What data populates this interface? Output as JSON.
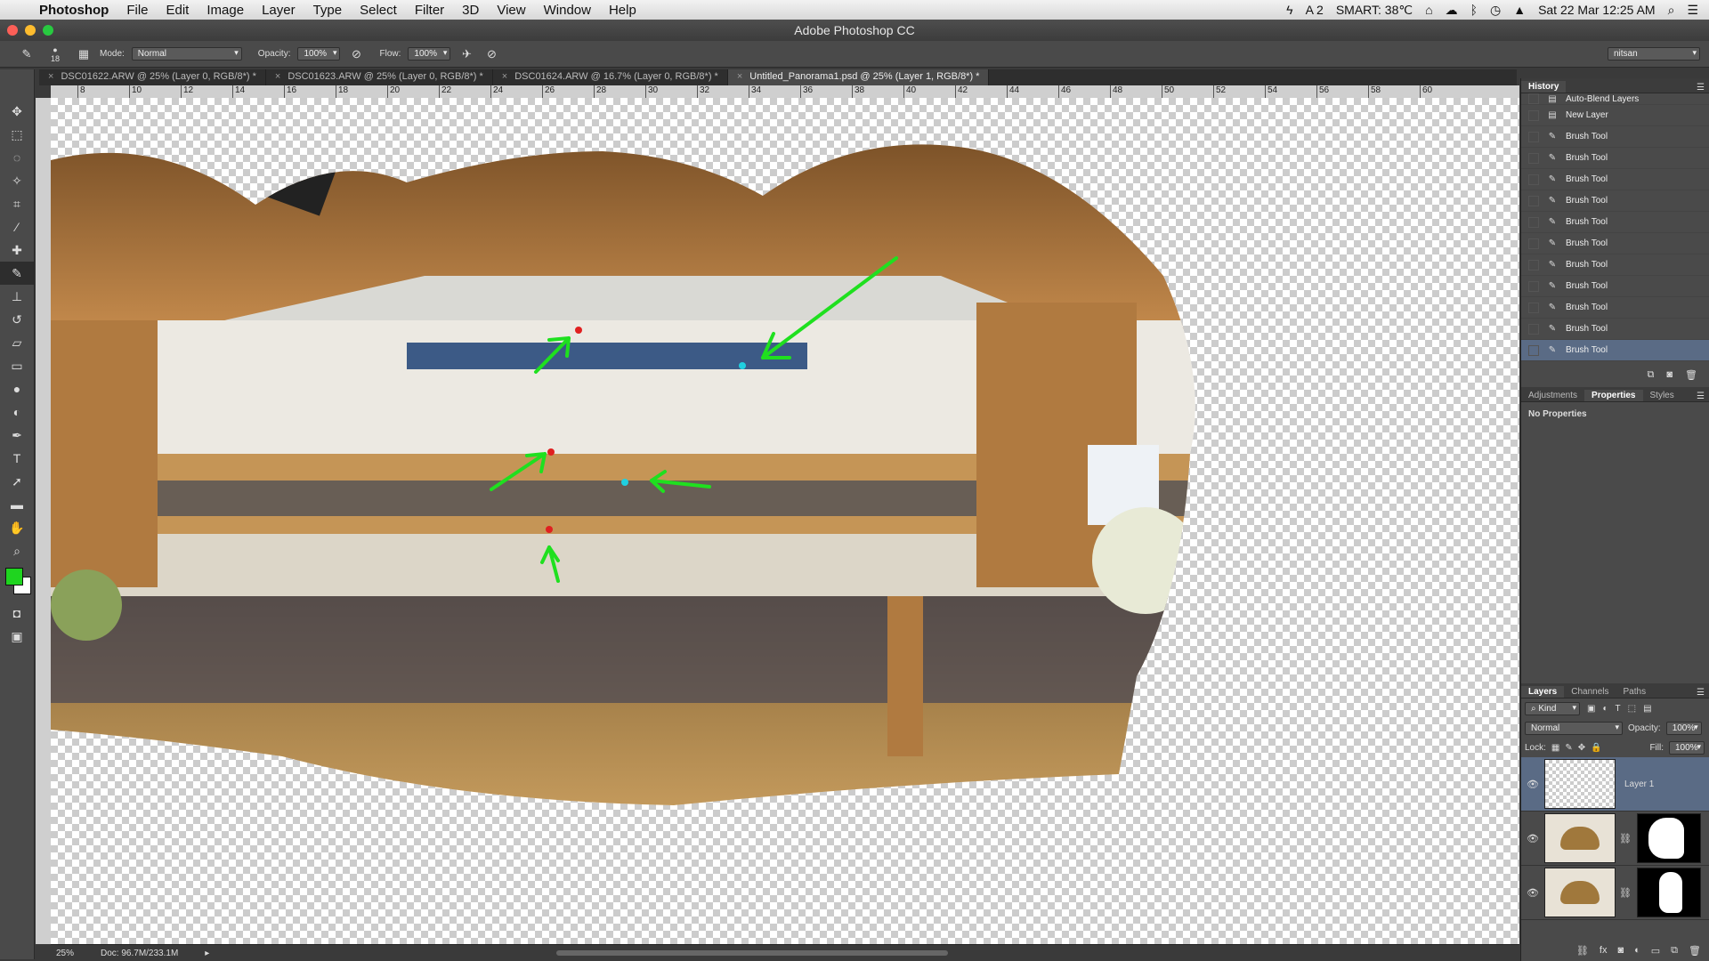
{
  "menubar": {
    "items": [
      "Photoshop",
      "File",
      "Edit",
      "Image",
      "Layer",
      "Type",
      "Select",
      "Filter",
      "3D",
      "View",
      "Window",
      "Help"
    ],
    "status": {
      "notifications": "2",
      "smart": "SMART: 38℃",
      "datetime": "Sat 22 Mar  12:25 AM"
    }
  },
  "window": {
    "title": "Adobe Photoshop CC"
  },
  "options": {
    "brush_size": "18",
    "mode_label": "Mode:",
    "mode_value": "Normal",
    "opacity_label": "Opacity:",
    "opacity_value": "100%",
    "flow_label": "Flow:",
    "flow_value": "100%",
    "workspace": "nitsan"
  },
  "tabs": [
    {
      "label": "DSC01622.ARW @ 25% (Layer 0, RGB/8*) *"
    },
    {
      "label": "DSC01623.ARW @ 25% (Layer 0, RGB/8*) *"
    },
    {
      "label": "DSC01624.ARW @ 16.7% (Layer 0, RGB/8*) *"
    },
    {
      "label": "Untitled_Panorama1.psd @ 25% (Layer 1, RGB/8*) *"
    }
  ],
  "ruler": {
    "ticks": [
      "8",
      "10",
      "12",
      "14",
      "16",
      "18",
      "20",
      "22",
      "24",
      "26",
      "28",
      "30",
      "32",
      "34",
      "36",
      "38",
      "40",
      "42",
      "44",
      "46",
      "48",
      "50",
      "52",
      "54",
      "56",
      "58",
      "60"
    ]
  },
  "toolbar": {
    "foreground_color": "#1fd41f",
    "background_color": "#ffffff"
  },
  "statusbar": {
    "zoom": "25%",
    "doc": "Doc: 96.7M/233.1M"
  },
  "history": {
    "tab": "History",
    "items": [
      "Auto-Blend Layers",
      "New Layer",
      "Brush Tool",
      "Brush Tool",
      "Brush Tool",
      "Brush Tool",
      "Brush Tool",
      "Brush Tool",
      "Brush Tool",
      "Brush Tool",
      "Brush Tool",
      "Brush Tool",
      "Brush Tool"
    ]
  },
  "properties": {
    "tabs": [
      "Adjustments",
      "Properties",
      "Styles"
    ],
    "content": "No Properties"
  },
  "layers": {
    "tabs": [
      "Layers",
      "Channels",
      "Paths"
    ],
    "kind": "Kind",
    "blend_mode": "Normal",
    "opacity_label": "Opacity:",
    "opacity_value": "100%",
    "lock_label": "Lock:",
    "fill_label": "Fill:",
    "fill_value": "100%",
    "items": [
      {
        "name": "Layer 1"
      },
      {
        "name": ""
      },
      {
        "name": ""
      }
    ]
  },
  "colors": {
    "accent": "#5a6b85",
    "annotation_green": "#1fe01f"
  }
}
